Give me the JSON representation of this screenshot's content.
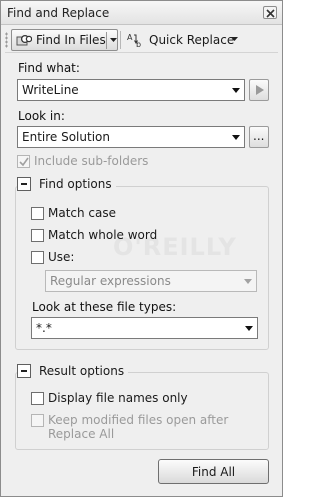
{
  "window": {
    "title": "Find and Replace"
  },
  "toolbar": {
    "find_in_files": "Find In Files",
    "quick_replace": "Quick Replace",
    "replace_icon_glyph": "A↓b"
  },
  "find_what": {
    "label": "Find what:",
    "value": "WriteLine"
  },
  "look_in": {
    "label": "Look in:",
    "value": "Entire Solution",
    "browse_label": "..."
  },
  "include_subfolders": {
    "label": "Include sub-folders",
    "checked": true
  },
  "find_options": {
    "header": "Find options",
    "match_case": "Match case",
    "match_whole_word": "Match whole word",
    "use": "Use:",
    "use_value": "Regular expressions",
    "file_types_label": "Look at these file types:",
    "file_types_value": "*.*"
  },
  "result_options": {
    "header": "Result options",
    "display_file_names": "Display file names only",
    "keep_open_line1": "Keep modified files open after",
    "keep_open_line2": "Replace All"
  },
  "actions": {
    "find_all": "Find All"
  },
  "watermark": "O'REILLY"
}
